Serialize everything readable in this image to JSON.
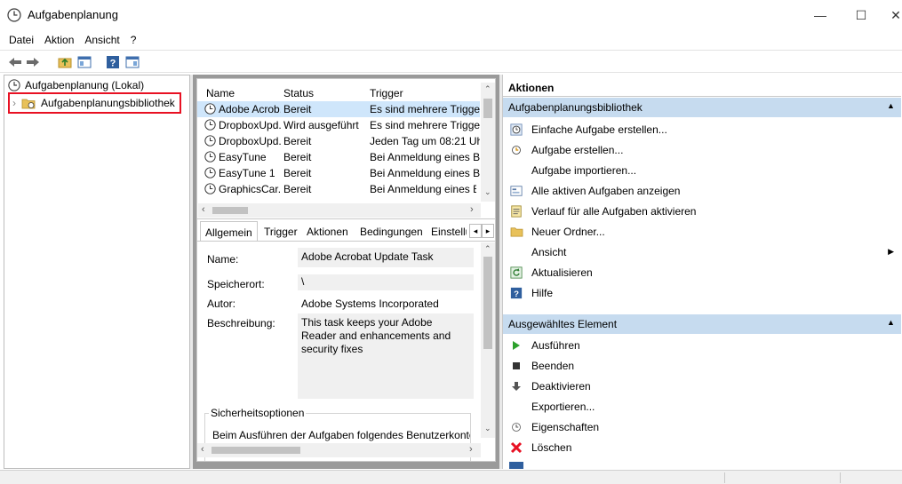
{
  "window": {
    "title": "Aufgabenplanung",
    "controls": {
      "minimize": "—",
      "maximize": "☐",
      "close": "✕"
    }
  },
  "menu": [
    "Datei",
    "Aktion",
    "Ansicht",
    "?"
  ],
  "toolbar": [
    "back-icon",
    "forward-icon",
    "up-folder-icon",
    "show-hide-pane-icon",
    "help-icon",
    "properties-icon"
  ],
  "tree": {
    "root": "Aufgabenplanung (Lokal)",
    "child": "Aufgabenplanungsbibliothek",
    "expander": "›"
  },
  "task_list": {
    "columns": [
      "Name",
      "Status",
      "Trigger"
    ],
    "rows": [
      {
        "name": "Adobe Acrob...",
        "status": "Bereit",
        "trigger": "Es sind mehrere Trigger",
        "selected": true
      },
      {
        "name": "DropboxUpd...",
        "status": "Wird ausgeführt",
        "trigger": "Es sind mehrere Trigger",
        "selected": false
      },
      {
        "name": "DropboxUpd...",
        "status": "Bereit",
        "trigger": "Jeden Tag um 08:21 Uh",
        "selected": false
      },
      {
        "name": "EasyTune",
        "status": "Bereit",
        "trigger": "Bei Anmeldung eines B",
        "selected": false
      },
      {
        "name": "EasyTune 1",
        "status": "Bereit",
        "trigger": "Bei Anmeldung eines B",
        "selected": false
      },
      {
        "name": "GraphicsCar...",
        "status": "Bereit",
        "trigger": "Bei Anmeldung eines B",
        "selected": false
      }
    ]
  },
  "details": {
    "tabs": [
      "Allgemein",
      "Trigger",
      "Aktionen",
      "Bedingungen",
      "Einstellu"
    ],
    "active_tab": "Allgemein",
    "name_label": "Name:",
    "name_value": "Adobe Acrobat Update Task",
    "location_label": "Speicherort:",
    "location_value": "\\",
    "author_label": "Autor:",
    "author_value": "Adobe Systems Incorporated",
    "description_label": "Beschreibung:",
    "description_value": "This task keeps your Adobe Reader and enhancements and security fixes",
    "security_group": "Sicherheitsoptionen",
    "security_text": "Beim Ausführen der Aufgaben folgendes Benutzerkonto v"
  },
  "actions": {
    "header": "Aktionen",
    "sections": [
      {
        "title": "Aufgabenplanungsbibliothek",
        "items": [
          {
            "label": "Einfache Aufgabe erstellen...",
            "icon": "simple-task-icon"
          },
          {
            "label": "Aufgabe erstellen...",
            "icon": "task-create-icon"
          },
          {
            "label": "Aufgabe importieren...",
            "icon": ""
          },
          {
            "label": "Alle aktiven Aufgaben anzeigen",
            "icon": "active-tasks-icon"
          },
          {
            "label": "Verlauf für alle Aufgaben aktivieren",
            "icon": "history-icon"
          },
          {
            "label": "Neuer Ordner...",
            "icon": "new-folder-icon"
          },
          {
            "label": "Ansicht",
            "icon": "",
            "submenu": true
          },
          {
            "label": "Aktualisieren",
            "icon": "refresh-icon"
          },
          {
            "label": "Hilfe",
            "icon": "help-icon"
          }
        ]
      },
      {
        "title": "Ausgewähltes Element",
        "items": [
          {
            "label": "Ausführen",
            "icon": "run-icon"
          },
          {
            "label": "Beenden",
            "icon": "stop-icon"
          },
          {
            "label": "Deaktivieren",
            "icon": "disable-icon"
          },
          {
            "label": "Exportieren...",
            "icon": ""
          },
          {
            "label": "Eigenschaften",
            "icon": "properties-icon"
          },
          {
            "label": "Löschen",
            "icon": "delete-icon"
          }
        ]
      }
    ]
  },
  "colors": {
    "section_bg": "#c6dbef",
    "selection_highlight": "#e81123",
    "row_selected": "#cfe6fb"
  }
}
